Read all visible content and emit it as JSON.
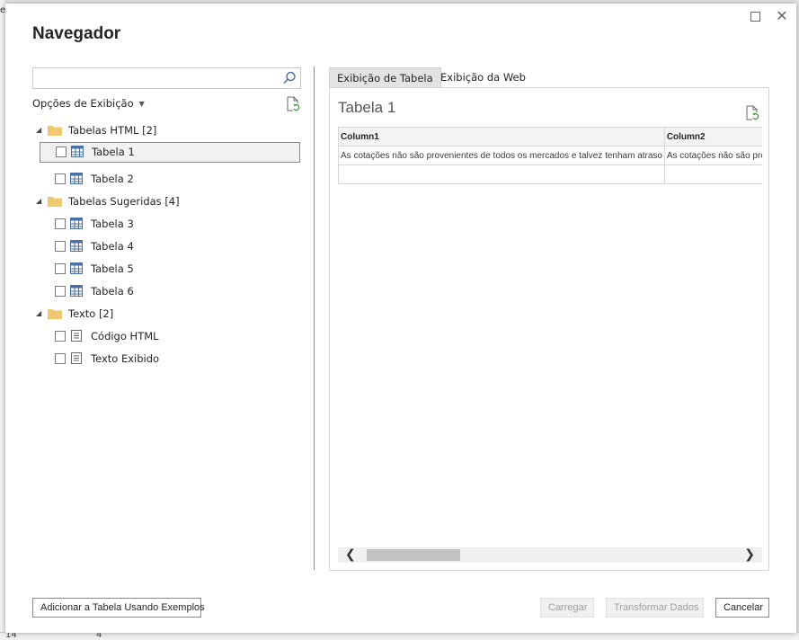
{
  "background": {
    "edge_text": "e",
    "bottom_left_number": "14",
    "bottom_mid_number": "4"
  },
  "dialog": {
    "title": "Navegador",
    "search": {
      "value": "",
      "placeholder": ""
    },
    "display_options_label": "Opções de Exibição",
    "tree": [
      {
        "label": "Tabelas HTML [2]",
        "expanded": true,
        "icon": "folder-icon",
        "children": [
          {
            "label": "Tabela 1",
            "icon": "table-icon",
            "selected": true,
            "checked": false
          },
          {
            "label": "Tabela 2",
            "icon": "table-icon",
            "selected": false,
            "checked": false
          }
        ]
      },
      {
        "label": "Tabelas Sugeridas [4]",
        "expanded": true,
        "icon": "folder-icon",
        "children": [
          {
            "label": "Tabela 3",
            "icon": "table-icon",
            "checked": false
          },
          {
            "label": "Tabela 4",
            "icon": "table-icon",
            "checked": false
          },
          {
            "label": "Tabela 5",
            "icon": "table-icon",
            "checked": false
          },
          {
            "label": "Tabela 6",
            "icon": "table-icon",
            "checked": false
          }
        ]
      },
      {
        "label": "Texto [2]",
        "expanded": true,
        "icon": "folder-icon",
        "children": [
          {
            "label": "Código HTML",
            "icon": "document-icon",
            "checked": false
          },
          {
            "label": "Texto Exibido",
            "icon": "document-icon",
            "checked": false
          }
        ]
      }
    ],
    "tabs": [
      {
        "label": "Exibição de Tabela",
        "active": true
      },
      {
        "label": "Exibição da Web",
        "active": false
      }
    ],
    "preview": {
      "title": "Tabela 1",
      "columns": [
        "Column1",
        "Column2"
      ],
      "rows": [
        [
          "As cotações não são provenientes de todos os mercados e talvez tenham atraso",
          "As cotações não são provenientes"
        ],
        [
          "",
          ""
        ]
      ]
    },
    "buttons": {
      "add_table": "Adicionar a Tabela Usando Exemplos",
      "load": "Carregar",
      "transform": "Transformar Dados",
      "cancel": "Cancelar"
    },
    "colors": {
      "folder": "#f0c871",
      "table_icon": "#4a6fa5",
      "selection_border": "#8a8a8a"
    }
  }
}
